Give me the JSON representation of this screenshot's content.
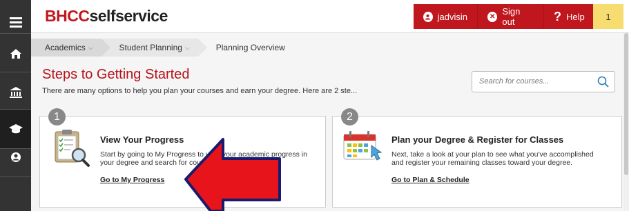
{
  "header": {
    "logo_part1": "BHCC",
    "logo_part2": "selfservice",
    "user_label": "jadvisin",
    "signout_label": "Sign out",
    "help_label": "Help",
    "notification_count": "1"
  },
  "breadcrumbs": [
    {
      "label": "Academics"
    },
    {
      "label": "Student Planning"
    },
    {
      "label": "Planning Overview"
    }
  ],
  "page": {
    "title": "Steps to Getting Started",
    "subtitle": "There are many options to help you plan your courses and earn your degree. Here are 2 ste..."
  },
  "search": {
    "placeholder": "Search for courses..."
  },
  "steps": [
    {
      "number": "1",
      "title": "View Your Progress",
      "text": "Start by going to My Progress to view your academic progress in your degree and search for courses.",
      "link": "Go to My Progress"
    },
    {
      "number": "2",
      "title": "Plan your Degree & Register for Classes",
      "text": "Next, take a look at your plan to see what you've accomplished and register your remaining classes toward your degree.",
      "link": "Go to Plan & Schedule"
    }
  ],
  "colors": {
    "brand_red": "#c0161d",
    "rail_bg": "#333333",
    "title_red": "#b5121b",
    "notify_yellow": "#f7dc6f",
    "annotation_arrow": "#e8141c"
  }
}
